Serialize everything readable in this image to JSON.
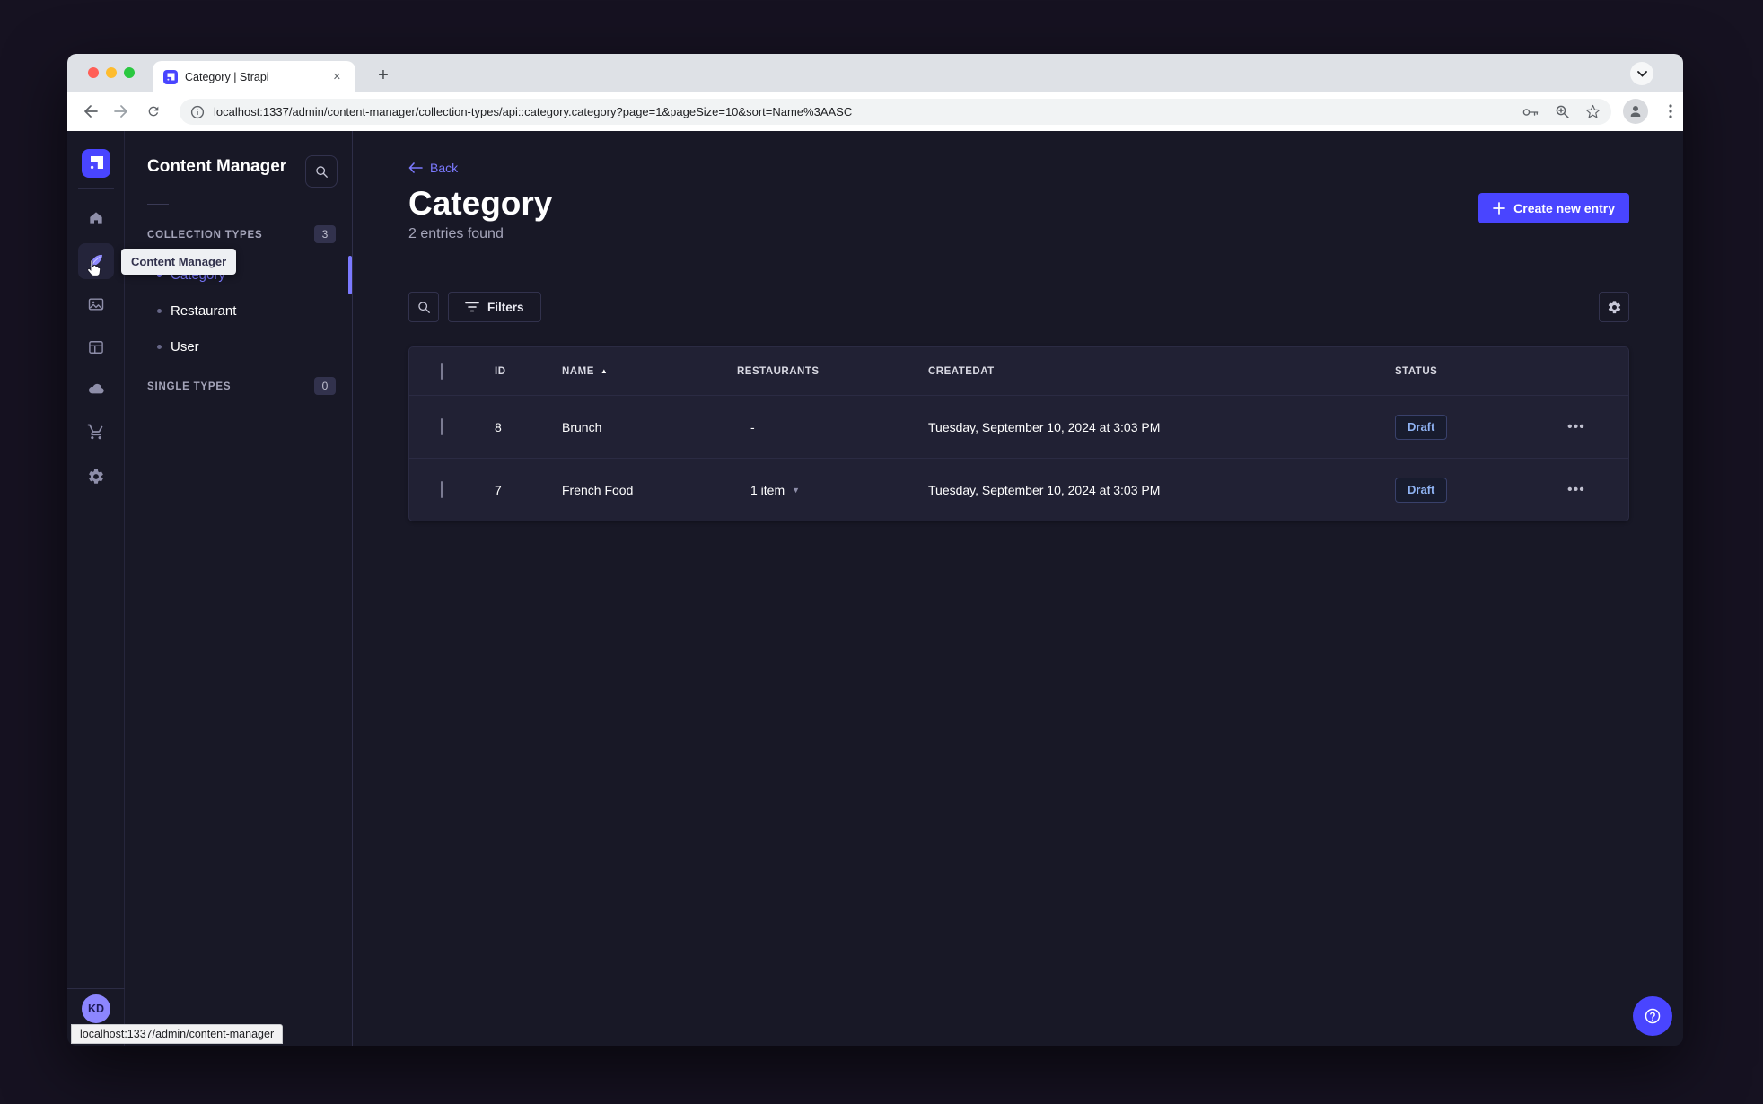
{
  "browser": {
    "tab_title": "Category | Strapi",
    "new_tab_glyph": "+",
    "close_glyph": "✕",
    "url": "localhost:1337/admin/content-manager/collection-types/api::category.category?page=1&pageSize=10&sort=Name%3AASC",
    "status_link": "localhost:1337/admin/content-manager"
  },
  "sidebar": {
    "tooltip": "Content Manager",
    "avatar_initials": "KD"
  },
  "subnav": {
    "title": "Content Manager",
    "collection_types": {
      "label": "COLLECTION TYPES",
      "count": "3",
      "items": [
        {
          "label": "Category"
        },
        {
          "label": "Restaurant"
        },
        {
          "label": "User"
        }
      ]
    },
    "single_types": {
      "label": "SINGLE TYPES",
      "count": "0"
    }
  },
  "main": {
    "back_label": "Back",
    "title": "Category",
    "subtitle": "2 entries found",
    "create_button_label": "Create new entry",
    "filters_label": "Filters",
    "table": {
      "headers": {
        "id": "ID",
        "name": "NAME",
        "restaurants": "RESTAURANTS",
        "createdat": "CREATEDAT",
        "status": "STATUS"
      },
      "sort_column": "NAME",
      "sort_direction": "asc",
      "rows": [
        {
          "id": "8",
          "name": "Brunch",
          "restaurants": "-",
          "createdat": "Tuesday, September 10, 2024 at 3:03 PM",
          "status": "Draft"
        },
        {
          "id": "7",
          "name": "French Food",
          "restaurants": "1 item",
          "createdat": "Tuesday, September 10, 2024 at 3:03 PM",
          "status": "Draft"
        }
      ],
      "row_actions_glyph": "•••"
    }
  },
  "colors": {
    "primary": "#4945ff",
    "primary_light": "#7b79ff",
    "draft_text": "#8fb3f3",
    "app_bg": "#181826",
    "panel_bg": "#212134"
  }
}
